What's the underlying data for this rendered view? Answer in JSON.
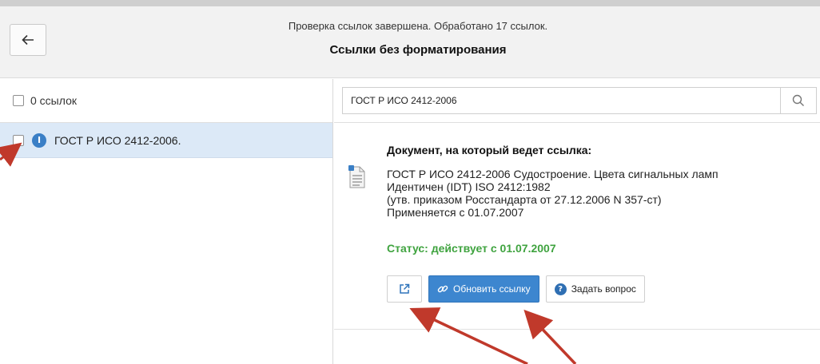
{
  "header": {
    "back_icon": "arrow-left-icon",
    "status_line": "Проверка ссылок завершена. Обработано 17 ссылок.",
    "title": "Ссылки без форматирования"
  },
  "left_panel": {
    "select_all_label": "0 ссылок",
    "items": [
      {
        "label": "ГОСТ Р ИСО 2412-2006.",
        "icon": "info-icon",
        "icon_glyph": "I"
      }
    ]
  },
  "search": {
    "value": "ГОСТ Р ИСО 2412-2006",
    "icon": "search-icon"
  },
  "document": {
    "heading": "Документ, на который ведет ссылка:",
    "icon": "document-icon",
    "lines": [
      "ГОСТ Р ИСО 2412-2006 Судостроение. Цвета сигнальных ламп",
      "Идентичен (IDT) ISO 2412:1982",
      "(утв. приказом Росстандарта от 27.12.2006 N 357-ст)",
      "Применяется с 01.07.2007"
    ],
    "status": "Статус: действует с 01.07.2007",
    "status_color": "#3fa33f"
  },
  "buttons": {
    "open_external_icon": "external-link-icon",
    "update_label": "Обновить ссылку",
    "update_icon": "link-icon",
    "ask_label": "Задать вопрос",
    "ask_icon": "question-icon",
    "ask_glyph": "?"
  },
  "colors": {
    "accent": "#3d86cf",
    "selected_row": "#dce9f7",
    "annotation_arrow": "#c0392b"
  }
}
